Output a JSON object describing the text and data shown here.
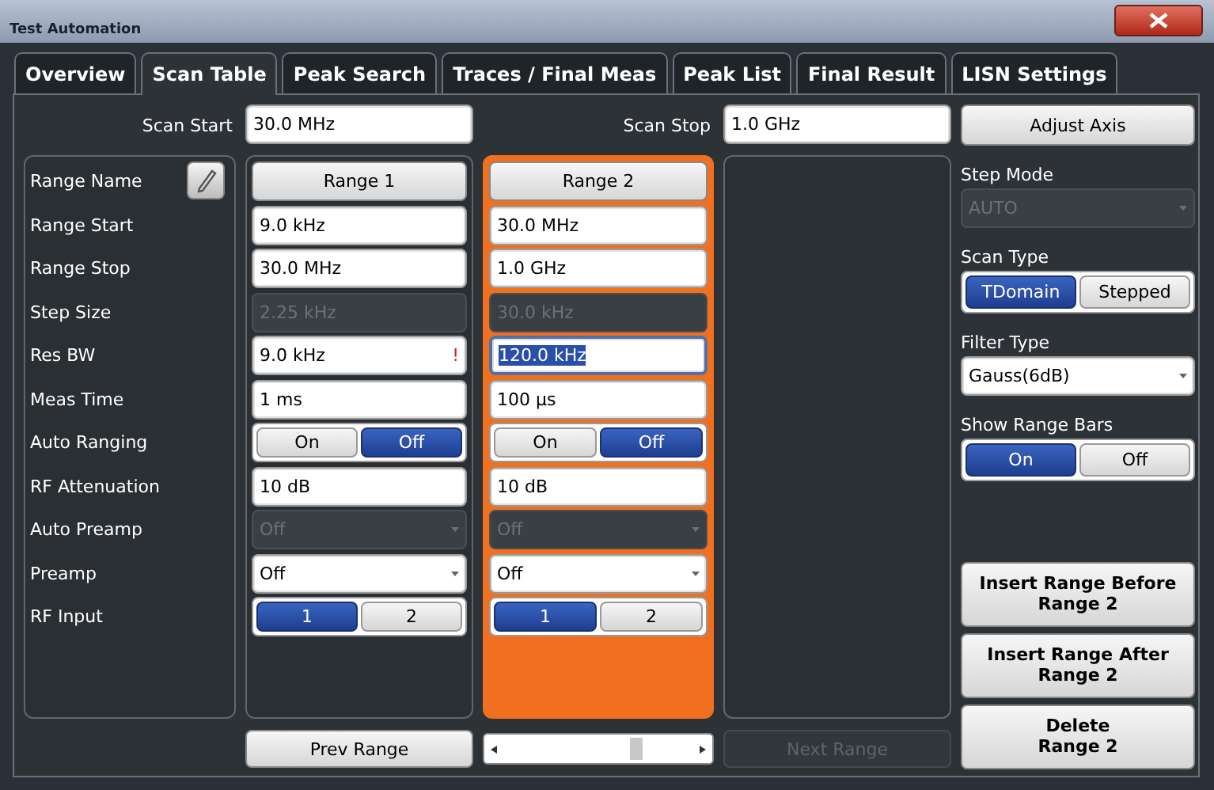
{
  "window": {
    "title": "Test Automation"
  },
  "tabs": [
    {
      "label": "Overview",
      "selected": false
    },
    {
      "label": "Scan Table",
      "selected": true
    },
    {
      "label": "Peak Search",
      "selected": false
    },
    {
      "label": "Traces / Final Meas",
      "selected": false
    },
    {
      "label": "Peak List",
      "selected": false
    },
    {
      "label": "Final Result",
      "selected": false
    },
    {
      "label": "LISN Settings",
      "selected": false
    }
  ],
  "scan_start": {
    "label": "Scan Start",
    "value": "30.0 MHz"
  },
  "scan_stop": {
    "label": "Scan Stop",
    "value": "1.0 GHz"
  },
  "adjust_axis": "Adjust Axis",
  "row_labels": [
    "Range Name",
    "Range Start",
    "Range Stop",
    "Step Size",
    "Res BW",
    "Meas Time",
    "Auto Ranging",
    "RF Attenuation",
    "Auto Preamp",
    "Preamp",
    "RF Input"
  ],
  "ranges": [
    {
      "name": "Range 1",
      "selected": false,
      "cells": [
        {
          "kind": "field",
          "value": "9.0 kHz",
          "disabled": false,
          "text_selected": false
        },
        {
          "kind": "field",
          "value": "30.0 MHz",
          "disabled": false,
          "text_selected": false
        },
        {
          "kind": "field",
          "value": "2.25 kHz",
          "disabled": true,
          "text_selected": false
        },
        {
          "kind": "field",
          "value": "9.0 kHz",
          "disabled": false,
          "text_selected": false,
          "warning": "!"
        },
        {
          "kind": "field",
          "value": "1 ms",
          "disabled": false,
          "text_selected": false
        },
        {
          "kind": "toggle",
          "options": [
            {
              "label": "On",
              "selected": false
            },
            {
              "label": "Off",
              "selected": true
            }
          ]
        },
        {
          "kind": "field",
          "value": "10 dB",
          "disabled": false,
          "text_selected": false
        },
        {
          "kind": "dropdown",
          "value": "Off",
          "disabled": true
        },
        {
          "kind": "dropdown",
          "value": "Off",
          "disabled": false
        },
        {
          "kind": "toggle",
          "options": [
            {
              "label": "1",
              "selected": true
            },
            {
              "label": "2",
              "selected": false
            }
          ]
        }
      ]
    },
    {
      "name": "Range 2",
      "selected": true,
      "cells": [
        {
          "kind": "field",
          "value": "30.0 MHz",
          "disabled": false,
          "text_selected": false
        },
        {
          "kind": "field",
          "value": "1.0 GHz",
          "disabled": false,
          "text_selected": false
        },
        {
          "kind": "field",
          "value": "30.0 kHz",
          "disabled": true,
          "text_selected": false
        },
        {
          "kind": "field",
          "value": "120.0 kHz",
          "disabled": false,
          "text_selected": true
        },
        {
          "kind": "field",
          "value": "100 µs",
          "disabled": false,
          "text_selected": false
        },
        {
          "kind": "toggle",
          "options": [
            {
              "label": "On",
              "selected": false
            },
            {
              "label": "Off",
              "selected": true
            }
          ]
        },
        {
          "kind": "field",
          "value": "10 dB",
          "disabled": false,
          "text_selected": false
        },
        {
          "kind": "dropdown",
          "value": "Off",
          "disabled": true
        },
        {
          "kind": "dropdown",
          "value": "Off",
          "disabled": false
        },
        {
          "kind": "toggle",
          "options": [
            {
              "label": "1",
              "selected": true
            },
            {
              "label": "2",
              "selected": false
            }
          ]
        }
      ]
    }
  ],
  "step_mode": {
    "label": "Step Mode",
    "value": "AUTO",
    "disabled": true
  },
  "scan_type": {
    "label": "Scan Type",
    "options": [
      {
        "label": "TDomain",
        "selected": true
      },
      {
        "label": "Stepped",
        "selected": false
      }
    ]
  },
  "filter_type": {
    "label": "Filter Type",
    "value": "Gauss(6dB)",
    "disabled": false
  },
  "show_range_bars": {
    "label": "Show Range Bars",
    "options": [
      {
        "label": "On",
        "selected": true
      },
      {
        "label": "Off",
        "selected": false
      }
    ]
  },
  "range_actions": [
    "Insert Range Before\nRange 2",
    "Insert Range After\nRange 2",
    "Delete\nRange 2"
  ],
  "prev_range": {
    "label": "Prev Range",
    "disabled": false
  },
  "next_range": {
    "label": "Next Range",
    "disabled": true
  }
}
